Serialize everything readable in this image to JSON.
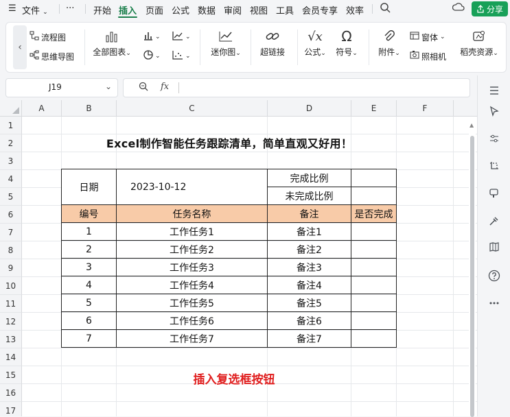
{
  "menubar": {
    "hamburger": "☰",
    "file": "文件",
    "more": "···",
    "tabs": [
      "开始",
      "插入",
      "页面",
      "公式",
      "数据",
      "审阅",
      "视图",
      "工具",
      "会员专享",
      "效率"
    ],
    "active_tab": "插入",
    "share": "分享"
  },
  "ribbon": {
    "flowchart": "流程图",
    "mindmap": "思维导图",
    "all_charts": "全部图表",
    "sparkline": "迷你图",
    "hyperlink": "超链接",
    "formula": "公式",
    "symbol": "符号",
    "attachment": "附件",
    "form": "窗体",
    "camera": "照相机",
    "shell_resources": "稻壳资源"
  },
  "formula_bar": {
    "cell_ref": "J19",
    "fx": "fx",
    "content": ""
  },
  "grid": {
    "columns": [
      "A",
      "B",
      "C",
      "D",
      "E",
      "F"
    ],
    "rows": [
      "1",
      "2",
      "3",
      "4",
      "5",
      "6",
      "7",
      "8",
      "9",
      "10",
      "11",
      "12",
      "13",
      "14",
      "15",
      "16",
      "17"
    ]
  },
  "sheet": {
    "title": "Excel制作智能任务跟踪清单，简单直观又好用！",
    "date_label": "日期",
    "date_value": "2023-10-12",
    "completion_ratio": "完成比例",
    "incomplete_ratio": "未完成比例",
    "headers": [
      "编号",
      "任务名称",
      "备注",
      "是否完成"
    ],
    "rows": [
      {
        "no": "1",
        "task": "工作任务1",
        "note": "备注1",
        "done": ""
      },
      {
        "no": "2",
        "task": "工作任务2",
        "note": "备注2",
        "done": ""
      },
      {
        "no": "3",
        "task": "工作任务3",
        "note": "备注3",
        "done": ""
      },
      {
        "no": "4",
        "task": "工作任务4",
        "note": "备注4",
        "done": ""
      },
      {
        "no": "5",
        "task": "工作任务5",
        "note": "备注5",
        "done": ""
      },
      {
        "no": "6",
        "task": "工作任务6",
        "note": "备注6",
        "done": ""
      },
      {
        "no": "7",
        "task": "工作任务7",
        "note": "备注7",
        "done": ""
      }
    ],
    "annotation": "插入复选框按钮"
  },
  "colors": {
    "accent": "#1a7f4b",
    "share_bg": "#18a058",
    "header_fill": "#f8cba8",
    "annotation": "#e01f1f"
  }
}
